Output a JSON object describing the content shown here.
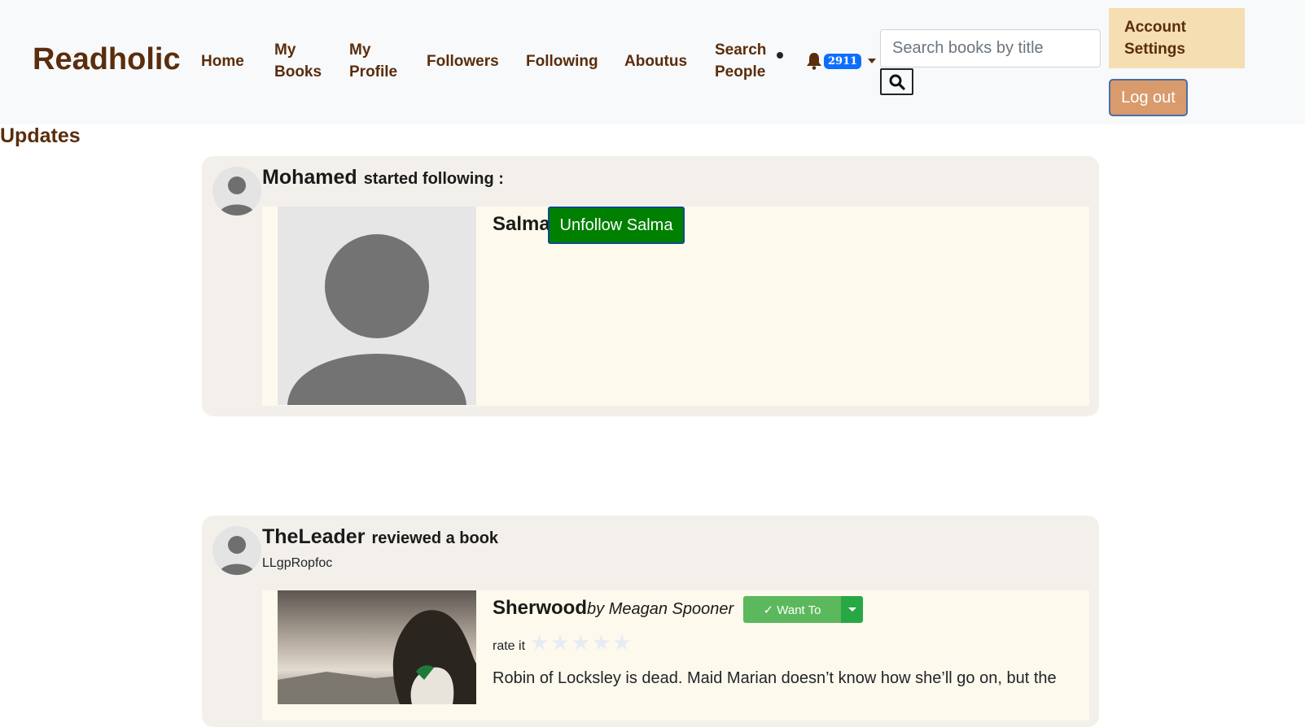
{
  "navbar": {
    "brand": "Readholic",
    "links": {
      "home": "Home",
      "my_books_1": "My",
      "my_books_2": "Books",
      "my_profile_1": "My",
      "my_profile_2": "Profile",
      "followers": "Followers",
      "following": "Following",
      "aboutus": "Aboutus",
      "search_people_1": "Search",
      "search_people_2": "People"
    },
    "notification_count": "2911",
    "search_placeholder": "Search books by title",
    "account_settings_1": "Account",
    "account_settings_2": "Settings",
    "logout": "Log out"
  },
  "updates_title": "Updates",
  "feed": [
    {
      "actor": "Mohamed",
      "action": "started following :",
      "target_name": "Salma",
      "target_button": "Unfollow Salma"
    },
    {
      "actor": "TheLeader",
      "action": "reviewed a book",
      "subline": "LLgpRopfoc",
      "book_title": "Sherwood",
      "book_author": "by Meagan Spooner",
      "shelf_button": "✓ Want To",
      "rate_label": "rate it",
      "rating": 0,
      "max_rating": 5,
      "description": "Robin of Locksley is dead. Maid Marian doesn’t know how she’ll go on, but the"
    }
  ],
  "colors": {
    "brand": "#5a2d0c",
    "navbar_bg": "#f8f9fa",
    "account_bg": "#f4deb2",
    "logout_bg": "#d99a6c",
    "unfollow_bg": "#008000",
    "want_bg": "#5cb85c",
    "badge_bg": "#0d6efd",
    "card_bg": "#f3f0eb",
    "inner_bg": "#fdf9ec"
  },
  "icons": [
    "bell-icon",
    "search-icon",
    "caret-down-icon",
    "user-avatar-icon",
    "star-icon"
  ]
}
